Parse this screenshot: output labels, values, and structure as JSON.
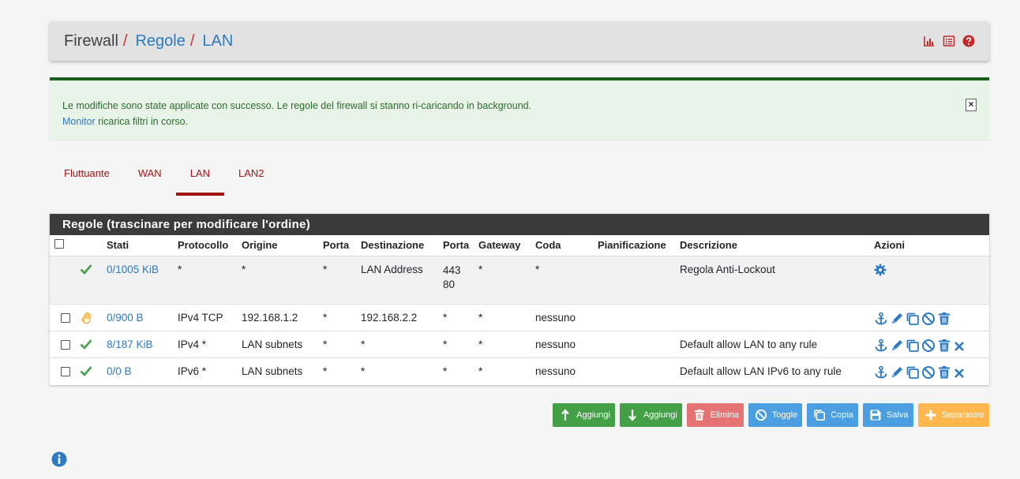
{
  "breadcrumb": {
    "part1": "Firewall",
    "sep": "/",
    "part2": "Regole",
    "part3": "LAN"
  },
  "header_icons": [
    "chart-icon",
    "list-icon",
    "help-icon"
  ],
  "alert": {
    "message": "Le modifiche sono state applicate con successo. Le regole del firewall si stanno ri-caricando in background.",
    "link": "Monitor",
    "rest": "ricarica filtri in corso.",
    "close": "×"
  },
  "tabs": [
    {
      "label": "Fluttuante",
      "active": false
    },
    {
      "label": "WAN",
      "active": false
    },
    {
      "label": "LAN",
      "active": true
    },
    {
      "label": "LAN2",
      "active": false
    }
  ],
  "panel": {
    "title": "Regole (trascinare per modificare l'ordine)",
    "columns": [
      "Stati",
      "Protocollo",
      "Origine",
      "Porta",
      "Destinazione",
      "Porta",
      "Gateway",
      "Coda",
      "Pianificazione",
      "Descrizione",
      "Azioni"
    ]
  },
  "rows": [
    {
      "status": "check",
      "stati": "0/1005 KiB",
      "protocollo": "*",
      "origine": "*",
      "porta_src": "*",
      "destinazione": "LAN Address",
      "porta_dst": "443",
      "porta_dst2": "80",
      "gateway": "*",
      "coda": "*",
      "pianificazione": "",
      "descrizione": "Regola Anti-Lockout",
      "actions": [
        "gear-icon"
      ]
    },
    {
      "status": "hand",
      "stati": "0/900 B",
      "protocollo": "IPv4 TCP",
      "origine": "192.168.1.2",
      "porta_src": "*",
      "destinazione": "192.168.2.2",
      "porta_dst": "*",
      "gateway": "*",
      "coda": "nessuno",
      "pianificazione": "",
      "descrizione": "",
      "actions": [
        "anchor-icon",
        "pencil-icon",
        "copy-icon",
        "disable-icon",
        "trash-icon"
      ]
    },
    {
      "status": "check",
      "stati": "8/187 KiB",
      "protocollo": "IPv4 *",
      "origine": "LAN subnets",
      "porta_src": "*",
      "destinazione": "*",
      "porta_dst": "*",
      "gateway": "*",
      "coda": "nessuno",
      "pianificazione": "",
      "descrizione": "Default allow LAN to any rule",
      "actions": [
        "anchor-icon",
        "pencil-icon",
        "copy-icon",
        "disable-icon",
        "trash-icon",
        "delete-x-icon"
      ]
    },
    {
      "status": "check",
      "stati": "0/0 B",
      "protocollo": "IPv6 *",
      "origine": "LAN subnets",
      "porta_src": "*",
      "destinazione": "*",
      "porta_dst": "*",
      "gateway": "*",
      "coda": "nessuno",
      "pianificazione": "",
      "descrizione": "Default allow LAN IPv6 to any rule",
      "actions": [
        "anchor-icon",
        "pencil-icon",
        "copy-icon",
        "disable-icon",
        "trash-icon",
        "delete-x-icon"
      ]
    }
  ],
  "buttons": {
    "add_top": "Aggiungi",
    "add_bottom": "Aggiungi",
    "delete": "Elimina",
    "toggle": "Toggle",
    "copy": "Copia",
    "save": "Salva",
    "separator": "Separatore"
  },
  "colors": {
    "link": "#2c7ac2",
    "tab": "#a31515",
    "green": "#43a047",
    "red": "#e57373",
    "blue": "#4b9fe0",
    "orange": "#ffb74d"
  }
}
